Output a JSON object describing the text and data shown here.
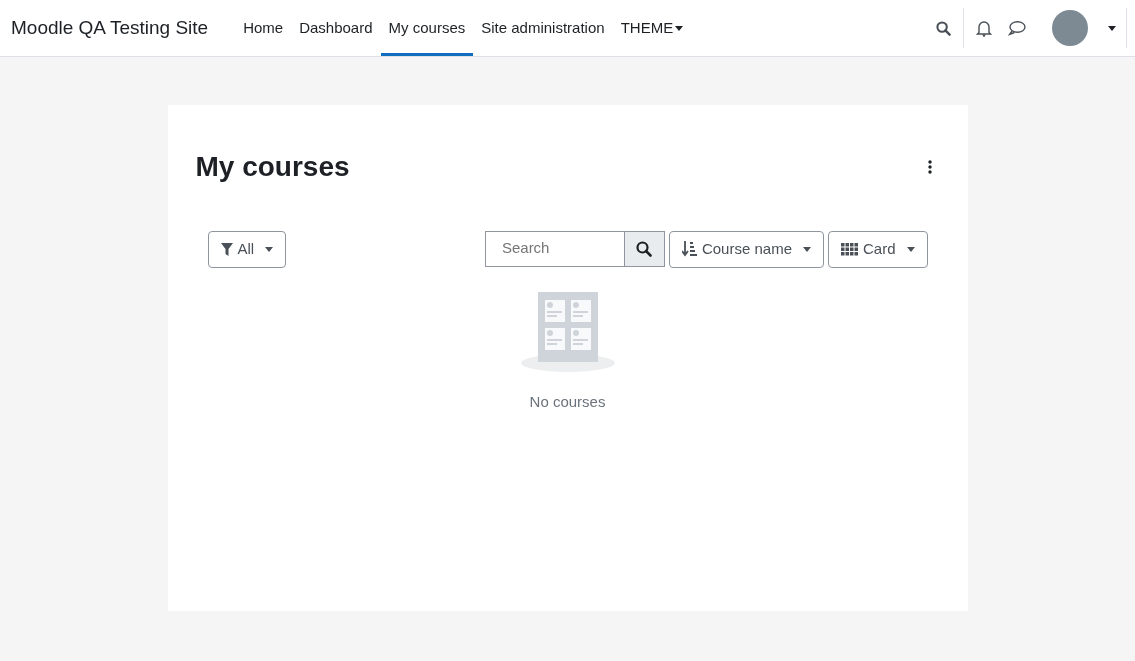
{
  "site_name": "Moodle QA Testing Site",
  "nav_items": [
    {
      "label": "Home",
      "selected": false,
      "kind": "link"
    },
    {
      "label": "Dashboard",
      "selected": false,
      "kind": "link"
    },
    {
      "label": "My courses",
      "selected": true,
      "kind": "link"
    },
    {
      "label": "Site administration",
      "selected": false,
      "kind": "link"
    },
    {
      "label": "THEME",
      "selected": false,
      "kind": "dropdown"
    }
  ],
  "page_title": "My courses",
  "filter": {
    "label": "All"
  },
  "search": {
    "placeholder": "Search"
  },
  "sort": {
    "label": "Course name"
  },
  "view": {
    "label": "Card"
  },
  "empty_message": "No courses"
}
